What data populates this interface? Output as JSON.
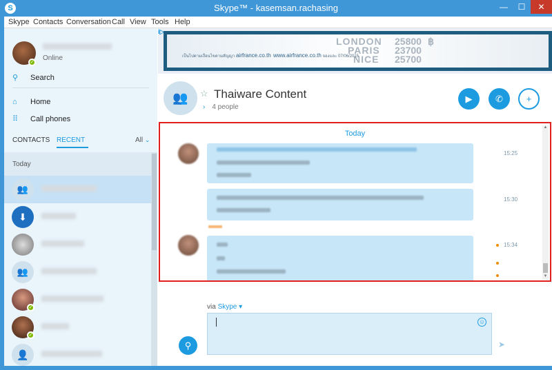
{
  "window": {
    "title": "Skype™ - kasemsan.rachasing",
    "app_icon": "skype-logo-icon",
    "minimize": "—",
    "maximize": "☐",
    "close": "✕",
    "accent": "#3f97d8",
    "close_color": "#c73a2a"
  },
  "menu": {
    "items": [
      "Skype",
      "Contacts",
      "Conversation",
      "Call",
      "View",
      "Tools",
      "Help"
    ]
  },
  "sidebar": {
    "me": {
      "status": "Online"
    },
    "search_label": "Search",
    "nav": [
      {
        "label": "Home",
        "icon": "home-icon"
      },
      {
        "label": "Call phones",
        "icon": "dialpad-icon"
      }
    ],
    "tabs": {
      "contacts": "CONTACTS",
      "recent": "RECENT",
      "filter": "All"
    },
    "list_header": "Today"
  },
  "ad": {
    "marker": "i▷",
    "cities": [
      "LONDON",
      "PARIS",
      "NICE"
    ],
    "prices": [
      "25800",
      "23700",
      "25700"
    ],
    "currency": "฿",
    "text_thai_lead": "เป็นไปตามเงื่อนไขตามสัญญา",
    "text_site": "airfrance.co.th",
    "text_site_big": "www.airfrance.co.th",
    "text_until": "จองและ 07/06/2015"
  },
  "conversation": {
    "title": "Thaiware Content",
    "people": "4 people",
    "video_icon": "video-call-icon",
    "call_icon": "phone-icon",
    "add_icon": "add-person-icon"
  },
  "chat": {
    "day_label": "Today",
    "messages": [
      {
        "time": "15:25"
      },
      {
        "time": "15:30"
      },
      {
        "time": "15:34"
      }
    ]
  },
  "composer": {
    "via_label": "via",
    "via_service": "Skype",
    "emoji_icon": "emoticon-icon",
    "attach_icon": "paperclip-icon",
    "send_icon": "send-icon"
  },
  "colors": {
    "skype_blue": "#1c9be0",
    "highlight_border": "#e01f1f",
    "bubble": "#c7e6f8",
    "unread": "#f08c00"
  }
}
